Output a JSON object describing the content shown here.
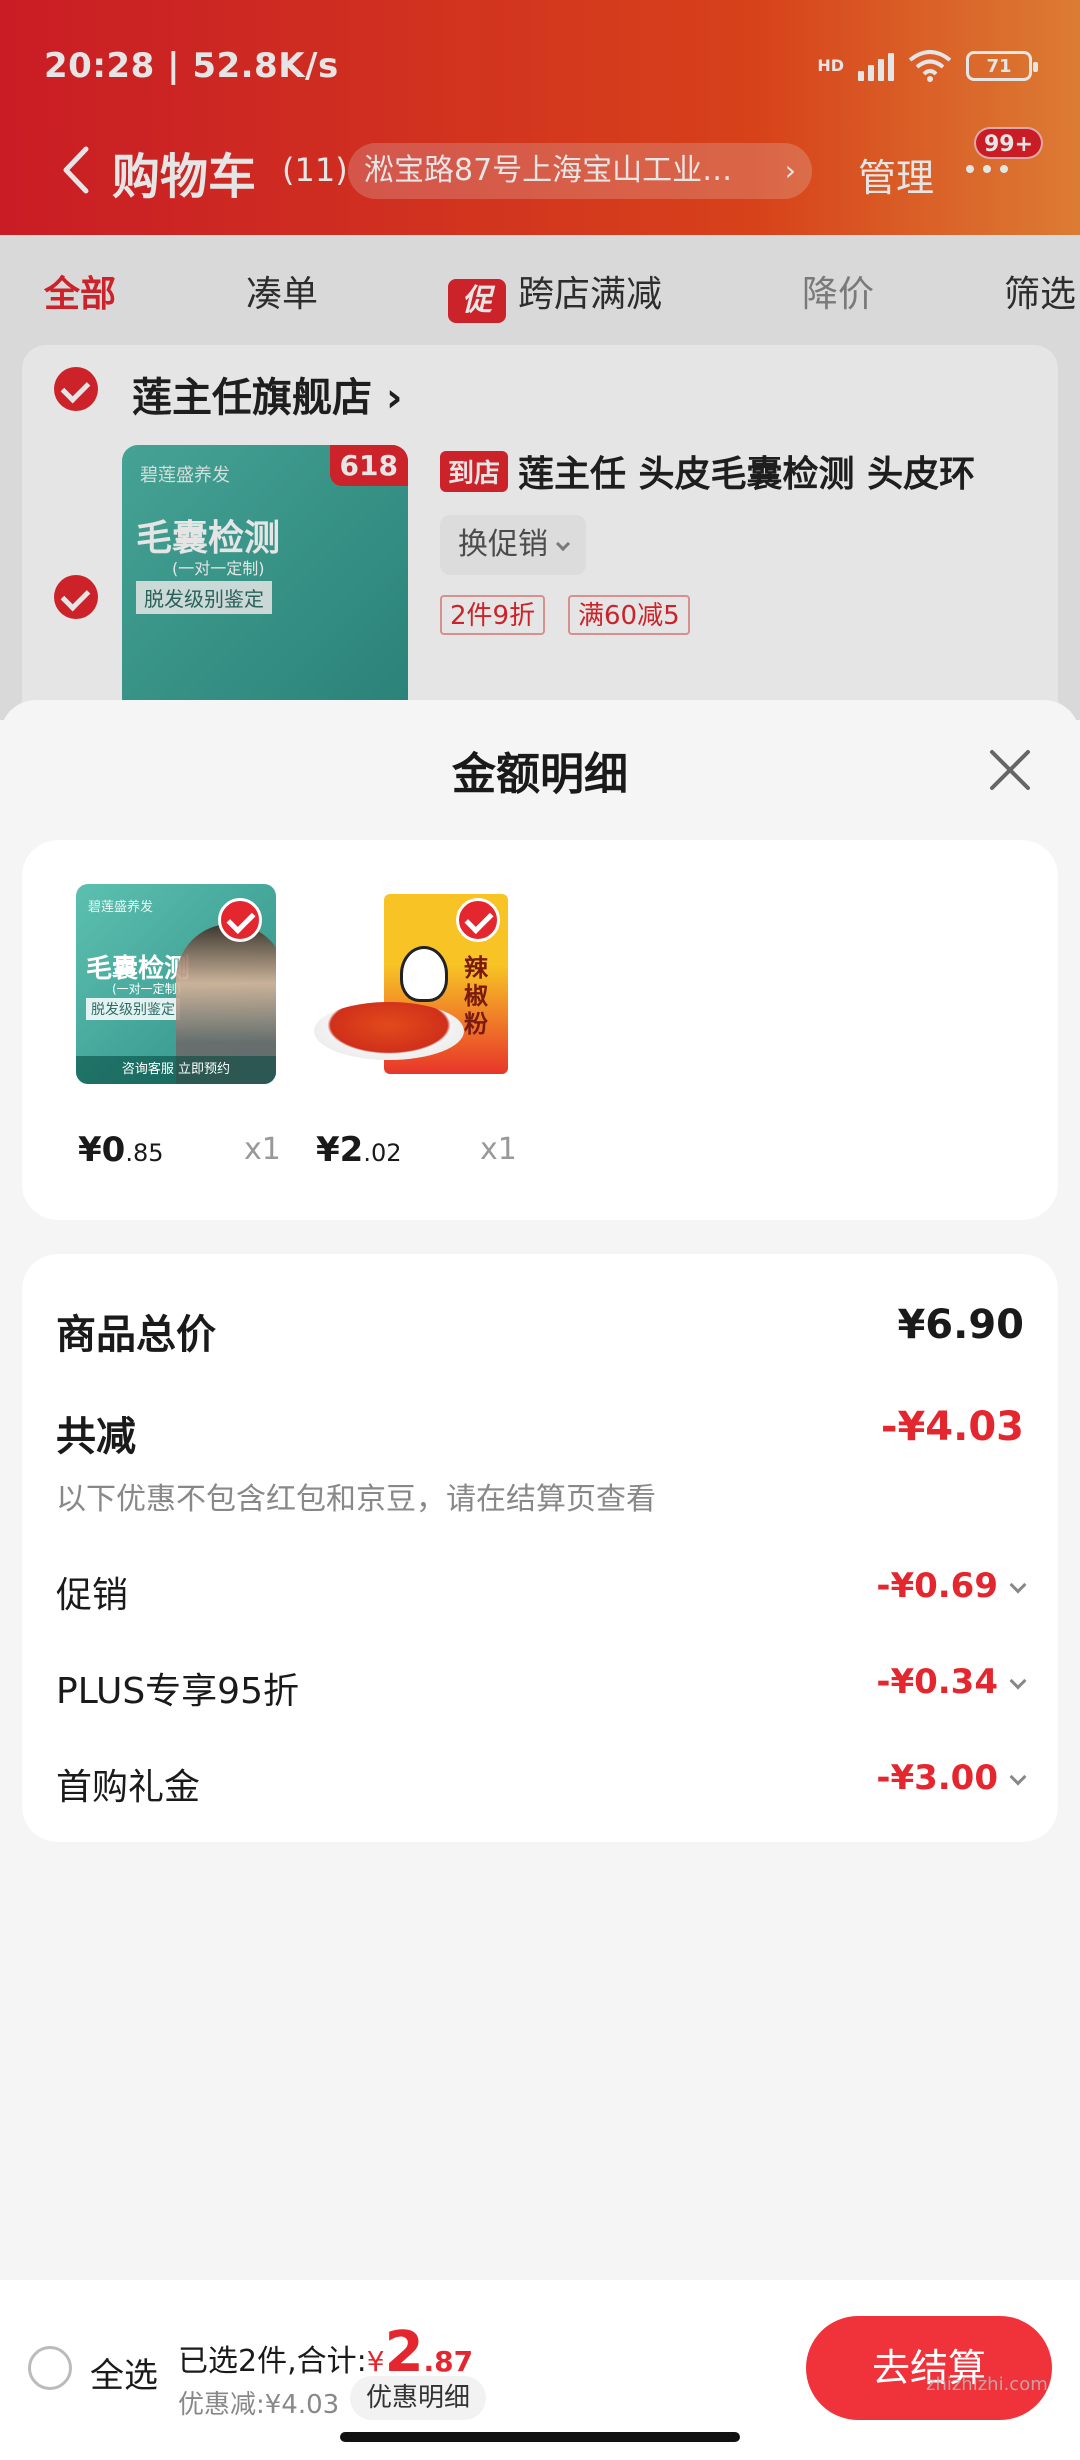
{
  "status_bar": {
    "time": "20:28 | 52.8K/s",
    "hd": "HD",
    "battery": "71"
  },
  "nav": {
    "title": "购物车",
    "count": "(11)",
    "address": "淞宝路87号上海宝山工业…",
    "manage": "管理",
    "badge": "99+"
  },
  "filter_tabs": [
    {
      "label": "全部"
    },
    {
      "label": "凑单"
    },
    {
      "label": "跨店满减",
      "tag": "促"
    },
    {
      "label": "降价"
    },
    {
      "label": "筛选"
    }
  ],
  "store": {
    "name": "莲主任旗舰店",
    "chevron": "›",
    "product": {
      "store_tag": "到店",
      "title": "莲主任 头皮毛囊检测 头皮环",
      "swap_promo": "换促销",
      "badge_618": "618",
      "coupons": [
        "2件9折",
        "满60减5"
      ],
      "image_text": {
        "brand": "碧莲盛养发",
        "main": "毛囊检测",
        "sub": "(一对一定制)",
        "caption": "脱发级别鉴定",
        "footer": "咨询客服 立即预约"
      }
    }
  },
  "sheet": {
    "title": "金额明细",
    "items": [
      {
        "price_int": "¥0",
        "price_dec": ".85",
        "qty": "x1"
      },
      {
        "price_int": "¥2",
        "price_dec": ".02",
        "qty": "x1",
        "image_text": "辣椒粉"
      }
    ],
    "summary": {
      "total_label": "商品总价",
      "total_value": "¥6.90",
      "reduce_label": "共减",
      "reduce_value": "-¥4.03",
      "note": "以下优惠不包含红包和京豆，请在结算页查看",
      "lines": [
        {
          "label": "促销",
          "value": "-¥0.69"
        },
        {
          "label": "PLUS专享95折",
          "value": "-¥0.34"
        },
        {
          "label": "首购礼金",
          "value": "-¥3.00"
        }
      ]
    }
  },
  "bottom_bar": {
    "select_all": "全选",
    "selected_prefix": "已选2件,合计:",
    "total_yen": "¥",
    "total_int": "2",
    "total_dec": ".87",
    "discount": "优惠减:¥4.03",
    "detail_button": "优惠明细",
    "checkout": "去结算"
  },
  "watermark": "zhizhizhi.com",
  "colors": {
    "brand_red": "#e4262e",
    "header_gradient_start": "#e0202a",
    "header_gradient_end": "#f58a3a"
  }
}
